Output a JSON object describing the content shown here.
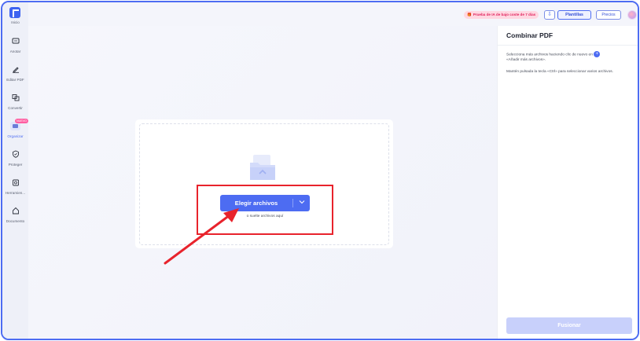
{
  "sidebar": {
    "home_label": "Inicio",
    "items": [
      {
        "label": "Anotar",
        "icon": "annotate-icon"
      },
      {
        "label": "Editar PDF",
        "icon": "edit-pdf-icon"
      },
      {
        "label": "Convertir",
        "icon": "convert-icon"
      },
      {
        "label": "Organizar",
        "icon": "organize-icon",
        "badge": "NUEVO"
      },
      {
        "label": "Proteger",
        "icon": "shield-icon"
      },
      {
        "label": "Herramien...",
        "icon": "tools-icon"
      },
      {
        "label": "Documento",
        "icon": "home-document-icon"
      }
    ],
    "active_index": 3
  },
  "topbar": {
    "promo": "Prueba de IA de bajo coste de 7 días",
    "templates_label": "Plantillas",
    "pricing_label": "Precios"
  },
  "main": {
    "choose_label": "Elegir archivos",
    "drop_hint": "o suelte archivos aquí"
  },
  "panel": {
    "title": "Combinar PDF",
    "instruction_a": "Selecciona más archivos haciendo clic de nuevo en",
    "instruction_b": "«Añadir más archivos».",
    "instruction_2": "Mantén pulsada la tecla «Ctrl» para seleccionar varios archivos.",
    "merge_label": "Fusionar"
  },
  "colors": {
    "accent": "#4d6cf2",
    "highlight": "#e8232c",
    "merge_disabled": "#c8d0fb"
  }
}
